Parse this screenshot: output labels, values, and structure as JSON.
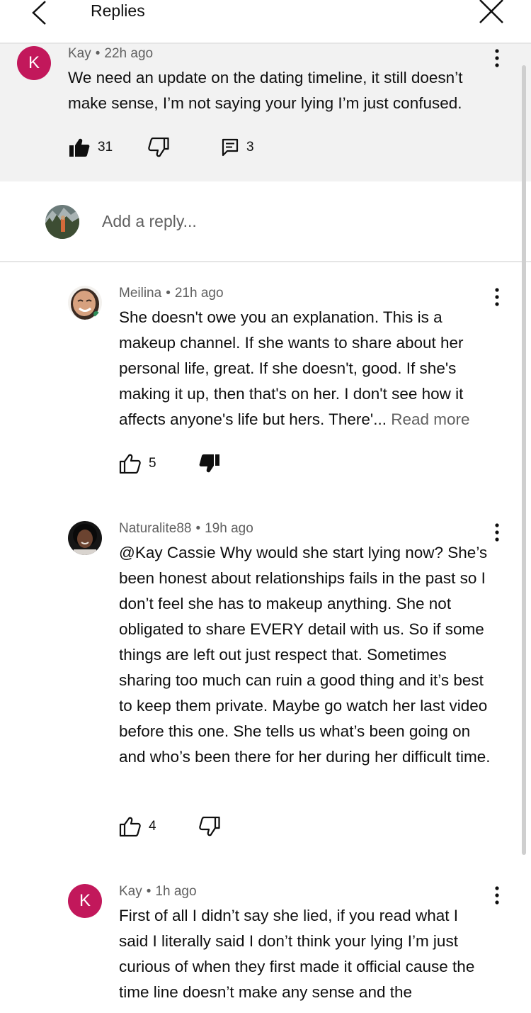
{
  "header": {
    "title": "Replies",
    "back_icon": "chevron-left-icon",
    "close_icon": "close-icon"
  },
  "pinned_comment": {
    "avatar_letter": "K",
    "avatar_color": "#c2185b",
    "author": "Kay",
    "time": "22h ago",
    "text": "We need an update on the dating timeline, it still doesn’t make sense, I’m not saying your lying I’m just confused.",
    "likes": "31",
    "replies": "3"
  },
  "reply_input": {
    "placeholder": "Add a reply..."
  },
  "replies": [
    {
      "author": "Meilina",
      "time": "21h ago",
      "text": "She doesn't owe you an explanation. This is a makeup channel. If she wants to share about her personal life, great. If she doesn't, good. If she's making it up, then that's on her. I don't see how it affects anyone's life but hers. There'...",
      "read_more": "Read more",
      "likes": "5"
    },
    {
      "author": "Naturalite88",
      "time": "19h ago",
      "text": "@Kay Cassie Why would she start lying now? She’s been honest about relationships fails in the past so I don’t feel she has to makeup anything. She not obligated to share EVERY detail with us. So if some things are left out just respect that. Sometimes sharing too much can ruin a good thing and it’s best to keep them private. Maybe go watch her last video before this one. She tells us what’s been going on and who’s been there for her during her difficult time.",
      "likes": "4"
    },
    {
      "avatar_letter": "K",
      "author": "Kay",
      "time": "1h ago",
      "text": "First of all I didn’t say she lied, if you read what I said I literally said I don’t think your lying I’m just curious of when they first made it official cause the time line doesn’t make any sense and the"
    }
  ]
}
